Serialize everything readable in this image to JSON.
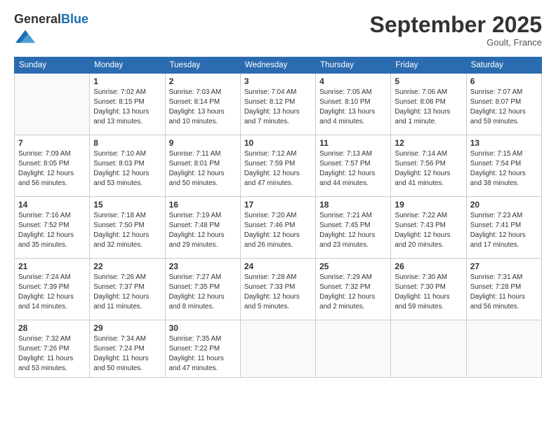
{
  "header": {
    "logo_general": "General",
    "logo_blue": "Blue",
    "month_title": "September 2025",
    "location": "Goult, France"
  },
  "weekdays": [
    "Sunday",
    "Monday",
    "Tuesday",
    "Wednesday",
    "Thursday",
    "Friday",
    "Saturday"
  ],
  "rows": [
    [
      {
        "day": "",
        "lines": []
      },
      {
        "day": "1",
        "lines": [
          "Sunrise: 7:02 AM",
          "Sunset: 8:15 PM",
          "Daylight: 13 hours",
          "and 13 minutes."
        ]
      },
      {
        "day": "2",
        "lines": [
          "Sunrise: 7:03 AM",
          "Sunset: 8:14 PM",
          "Daylight: 13 hours",
          "and 10 minutes."
        ]
      },
      {
        "day": "3",
        "lines": [
          "Sunrise: 7:04 AM",
          "Sunset: 8:12 PM",
          "Daylight: 13 hours",
          "and 7 minutes."
        ]
      },
      {
        "day": "4",
        "lines": [
          "Sunrise: 7:05 AM",
          "Sunset: 8:10 PM",
          "Daylight: 13 hours",
          "and 4 minutes."
        ]
      },
      {
        "day": "5",
        "lines": [
          "Sunrise: 7:06 AM",
          "Sunset: 8:08 PM",
          "Daylight: 13 hours",
          "and 1 minute."
        ]
      },
      {
        "day": "6",
        "lines": [
          "Sunrise: 7:07 AM",
          "Sunset: 8:07 PM",
          "Daylight: 12 hours",
          "and 59 minutes."
        ]
      }
    ],
    [
      {
        "day": "7",
        "lines": [
          "Sunrise: 7:09 AM",
          "Sunset: 8:05 PM",
          "Daylight: 12 hours",
          "and 56 minutes."
        ]
      },
      {
        "day": "8",
        "lines": [
          "Sunrise: 7:10 AM",
          "Sunset: 8:03 PM",
          "Daylight: 12 hours",
          "and 53 minutes."
        ]
      },
      {
        "day": "9",
        "lines": [
          "Sunrise: 7:11 AM",
          "Sunset: 8:01 PM",
          "Daylight: 12 hours",
          "and 50 minutes."
        ]
      },
      {
        "day": "10",
        "lines": [
          "Sunrise: 7:12 AM",
          "Sunset: 7:59 PM",
          "Daylight: 12 hours",
          "and 47 minutes."
        ]
      },
      {
        "day": "11",
        "lines": [
          "Sunrise: 7:13 AM",
          "Sunset: 7:57 PM",
          "Daylight: 12 hours",
          "and 44 minutes."
        ]
      },
      {
        "day": "12",
        "lines": [
          "Sunrise: 7:14 AM",
          "Sunset: 7:56 PM",
          "Daylight: 12 hours",
          "and 41 minutes."
        ]
      },
      {
        "day": "13",
        "lines": [
          "Sunrise: 7:15 AM",
          "Sunset: 7:54 PM",
          "Daylight: 12 hours",
          "and 38 minutes."
        ]
      }
    ],
    [
      {
        "day": "14",
        "lines": [
          "Sunrise: 7:16 AM",
          "Sunset: 7:52 PM",
          "Daylight: 12 hours",
          "and 35 minutes."
        ]
      },
      {
        "day": "15",
        "lines": [
          "Sunrise: 7:18 AM",
          "Sunset: 7:50 PM",
          "Daylight: 12 hours",
          "and 32 minutes."
        ]
      },
      {
        "day": "16",
        "lines": [
          "Sunrise: 7:19 AM",
          "Sunset: 7:48 PM",
          "Daylight: 12 hours",
          "and 29 minutes."
        ]
      },
      {
        "day": "17",
        "lines": [
          "Sunrise: 7:20 AM",
          "Sunset: 7:46 PM",
          "Daylight: 12 hours",
          "and 26 minutes."
        ]
      },
      {
        "day": "18",
        "lines": [
          "Sunrise: 7:21 AM",
          "Sunset: 7:45 PM",
          "Daylight: 12 hours",
          "and 23 minutes."
        ]
      },
      {
        "day": "19",
        "lines": [
          "Sunrise: 7:22 AM",
          "Sunset: 7:43 PM",
          "Daylight: 12 hours",
          "and 20 minutes."
        ]
      },
      {
        "day": "20",
        "lines": [
          "Sunrise: 7:23 AM",
          "Sunset: 7:41 PM",
          "Daylight: 12 hours",
          "and 17 minutes."
        ]
      }
    ],
    [
      {
        "day": "21",
        "lines": [
          "Sunrise: 7:24 AM",
          "Sunset: 7:39 PM",
          "Daylight: 12 hours",
          "and 14 minutes."
        ]
      },
      {
        "day": "22",
        "lines": [
          "Sunrise: 7:26 AM",
          "Sunset: 7:37 PM",
          "Daylight: 12 hours",
          "and 11 minutes."
        ]
      },
      {
        "day": "23",
        "lines": [
          "Sunrise: 7:27 AM",
          "Sunset: 7:35 PM",
          "Daylight: 12 hours",
          "and 8 minutes."
        ]
      },
      {
        "day": "24",
        "lines": [
          "Sunrise: 7:28 AM",
          "Sunset: 7:33 PM",
          "Daylight: 12 hours",
          "and 5 minutes."
        ]
      },
      {
        "day": "25",
        "lines": [
          "Sunrise: 7:29 AM",
          "Sunset: 7:32 PM",
          "Daylight: 12 hours",
          "and 2 minutes."
        ]
      },
      {
        "day": "26",
        "lines": [
          "Sunrise: 7:30 AM",
          "Sunset: 7:30 PM",
          "Daylight: 11 hours",
          "and 59 minutes."
        ]
      },
      {
        "day": "27",
        "lines": [
          "Sunrise: 7:31 AM",
          "Sunset: 7:28 PM",
          "Daylight: 11 hours",
          "and 56 minutes."
        ]
      }
    ],
    [
      {
        "day": "28",
        "lines": [
          "Sunrise: 7:32 AM",
          "Sunset: 7:26 PM",
          "Daylight: 11 hours",
          "and 53 minutes."
        ]
      },
      {
        "day": "29",
        "lines": [
          "Sunrise: 7:34 AM",
          "Sunset: 7:24 PM",
          "Daylight: 11 hours",
          "and 50 minutes."
        ]
      },
      {
        "day": "30",
        "lines": [
          "Sunrise: 7:35 AM",
          "Sunset: 7:22 PM",
          "Daylight: 11 hours",
          "and 47 minutes."
        ]
      },
      {
        "day": "",
        "lines": []
      },
      {
        "day": "",
        "lines": []
      },
      {
        "day": "",
        "lines": []
      },
      {
        "day": "",
        "lines": []
      }
    ]
  ]
}
